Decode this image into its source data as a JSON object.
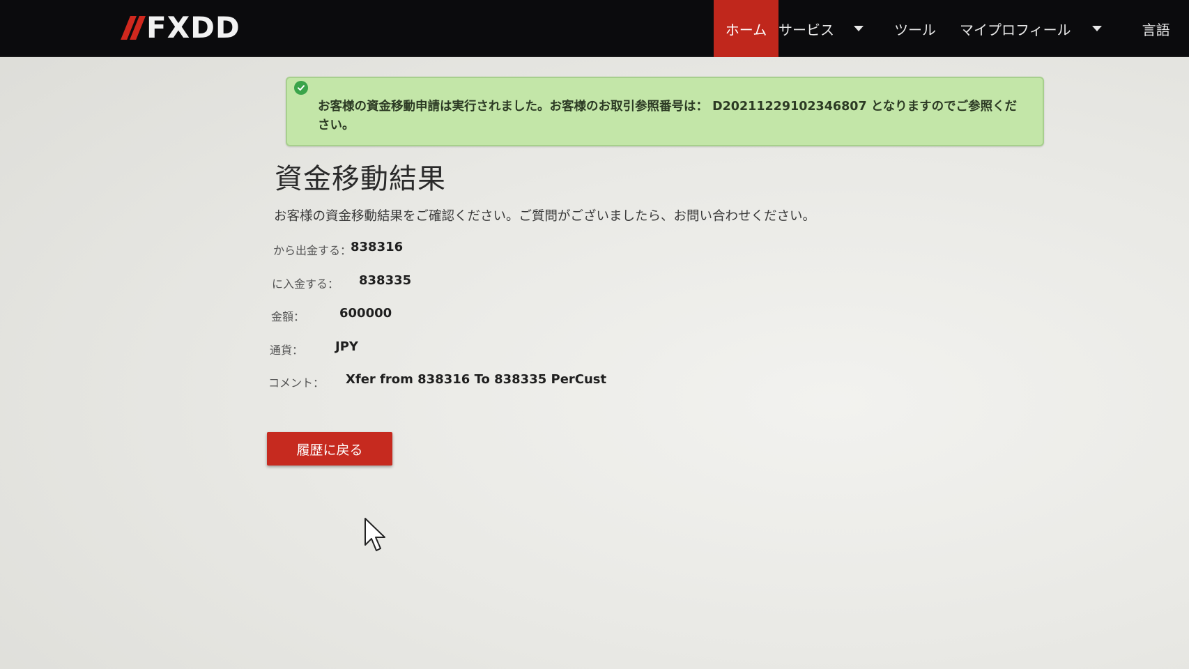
{
  "brand": {
    "name": "FXDD",
    "accent": "#c0271c"
  },
  "nav": {
    "home": "ホーム",
    "services": "サービス",
    "tools": "ツール",
    "profile": "マイプロフィール",
    "language": "言語"
  },
  "alert": {
    "icon": "check-circle-icon",
    "message": "お客様の資金移動申請は実行されました。お客様のお取引参照番号は： D20211229102346807 となりますのでご参照ください。"
  },
  "main": {
    "title": "資金移動結果",
    "description": "お客様の資金移動結果をご確認ください。ご質問がございましたら、お問い合わせください。",
    "fields": {
      "from": {
        "label": "から出金する：",
        "value": "838316"
      },
      "to": {
        "label": "に入金する：",
        "value": "838335"
      },
      "amount": {
        "label": "金額：",
        "value": "600000"
      },
      "currency": {
        "label": "通貨：",
        "value": "JPY"
      },
      "comment": {
        "label": "コメント：",
        "value": "Xfer from 838316 To 838335 PerCust"
      }
    },
    "back_button": "履歴に戻る"
  }
}
